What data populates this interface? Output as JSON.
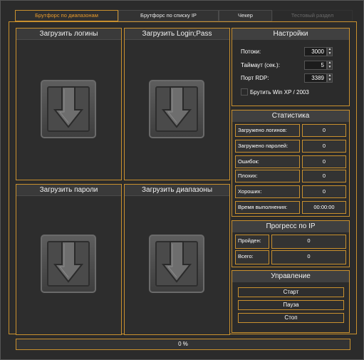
{
  "tabs": [
    {
      "label": "Брутфорс по диапазонам",
      "active": true
    },
    {
      "label": "Брутфорс по списку IP"
    },
    {
      "label": "Чекер"
    },
    {
      "label": "Тестовый раздел",
      "disabled": true
    }
  ],
  "panels": {
    "logins": "Загрузить логины",
    "loginpass": "Загрузить Login;Pass",
    "passwords": "Загрузить пароли",
    "ranges": "Загрузить диапазоны"
  },
  "settings": {
    "title": "Настройки",
    "threads_label": "Потоки:",
    "threads_value": "3000",
    "timeout_label": "Таймаут (сек.):",
    "timeout_value": "5",
    "rdp_label": "Порт RDP:",
    "rdp_value": "3389",
    "winxp_label": "Брутить Win XP / 2003",
    "winxp_checked": false
  },
  "stats": {
    "title": "Статистика",
    "rows": [
      {
        "label": "Загружено логинов:",
        "value": "0"
      },
      {
        "label": "Загружено паролей:",
        "value": "0"
      },
      {
        "label": "Ошибок:",
        "value": "0"
      },
      {
        "label": "Плохих:",
        "value": "0"
      },
      {
        "label": "Хороших:",
        "value": "0"
      },
      {
        "label": "Время выполнения:",
        "value": "00:00:00"
      }
    ]
  },
  "ipprogress": {
    "title": "Прогресс по IP",
    "rows": [
      {
        "label": "Пройден:",
        "value": "0"
      },
      {
        "label": "Всего:",
        "value": "0"
      }
    ]
  },
  "control": {
    "title": "Управление",
    "start": "Старт",
    "pause": "Пауза",
    "stop": "Стоп"
  },
  "progress": {
    "label": "0 %",
    "fraction": 0
  },
  "colors": {
    "accent": "#c9902e",
    "tab_active_text": "#e89a2c",
    "background": "#2b2b2b"
  },
  "icons": {
    "drop": "download-arrow-icon"
  }
}
